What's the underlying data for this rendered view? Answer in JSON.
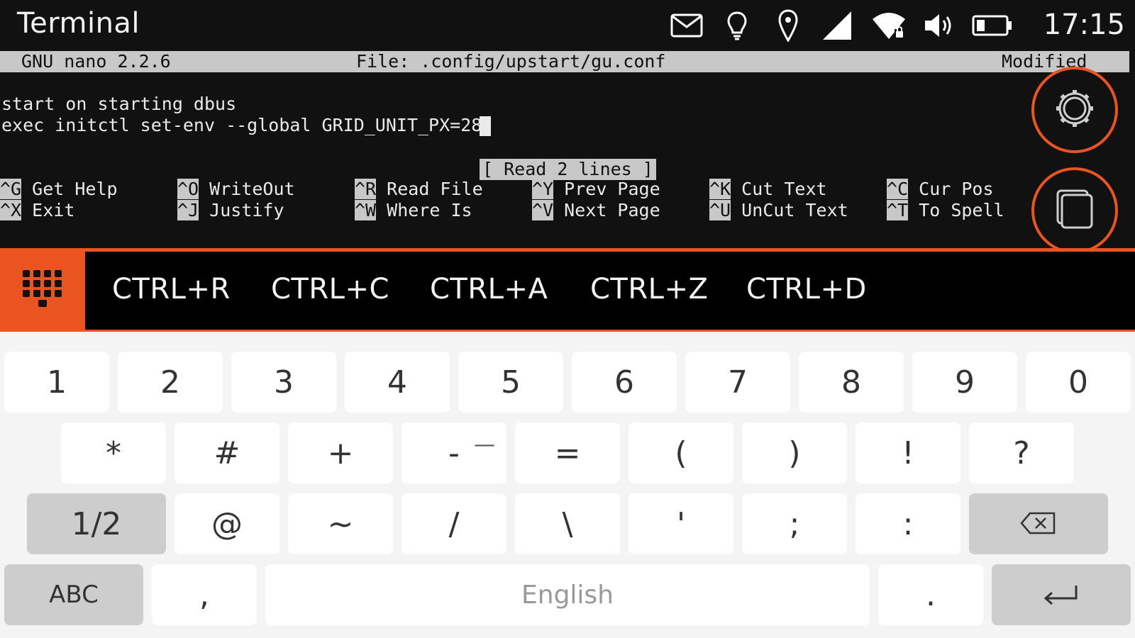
{
  "status_bar": {
    "app_title": "Terminal",
    "clock": "17:15",
    "icons": [
      "mail-icon",
      "lightbulb-icon",
      "location-pin-icon",
      "cellular-signal-icon",
      "wifi-locked-icon",
      "volume-icon",
      "battery-icon"
    ]
  },
  "nano": {
    "version": "GNU nano 2.2.6",
    "file": "File: .config/upstart/gu.conf",
    "state": "Modified",
    "lines": [
      "start on starting dbus",
      "exec initctl set-env --global GRID_UNIT_PX=28"
    ],
    "status_message": "[ Read 2 lines ]",
    "shortcuts": [
      {
        "key": "^G",
        "label": "Get Help"
      },
      {
        "key": "^O",
        "label": "WriteOut"
      },
      {
        "key": "^R",
        "label": "Read File"
      },
      {
        "key": "^Y",
        "label": "Prev Page"
      },
      {
        "key": "^K",
        "label": "Cut Text"
      },
      {
        "key": "^C",
        "label": "Cur Pos"
      },
      {
        "key": "^X",
        "label": "Exit"
      },
      {
        "key": "^J",
        "label": "Justify"
      },
      {
        "key": "^W",
        "label": "Where Is"
      },
      {
        "key": "^V",
        "label": "Next Page"
      },
      {
        "key": "^U",
        "label": "UnCut Text"
      },
      {
        "key": "^T",
        "label": "To Spell"
      }
    ]
  },
  "side_buttons": [
    "settings-icon",
    "windows-icon"
  ],
  "ctrl_keys": [
    "CTRL+R",
    "CTRL+C",
    "CTRL+A",
    "CTRL+Z",
    "CTRL+D"
  ],
  "keyboard": {
    "row1": [
      "1",
      "2",
      "3",
      "4",
      "5",
      "6",
      "7",
      "8",
      "9",
      "0"
    ],
    "row2": [
      "*",
      "#",
      "+",
      "-",
      "=",
      "(",
      ")",
      "!",
      "?"
    ],
    "row2_alt": "—",
    "row3": [
      "1/2",
      "@",
      "~",
      "/",
      "\\",
      "'",
      ";",
      ":"
    ],
    "row4": [
      "ABC",
      ",",
      "English",
      "."
    ],
    "icons": [
      "backspace-icon",
      "enter-icon"
    ]
  },
  "colors": {
    "accent": "#e95420",
    "terminal_bg": "#111111",
    "nano_bar": "#c8c8c8",
    "keyboard_bg": "#f4f4f4"
  }
}
